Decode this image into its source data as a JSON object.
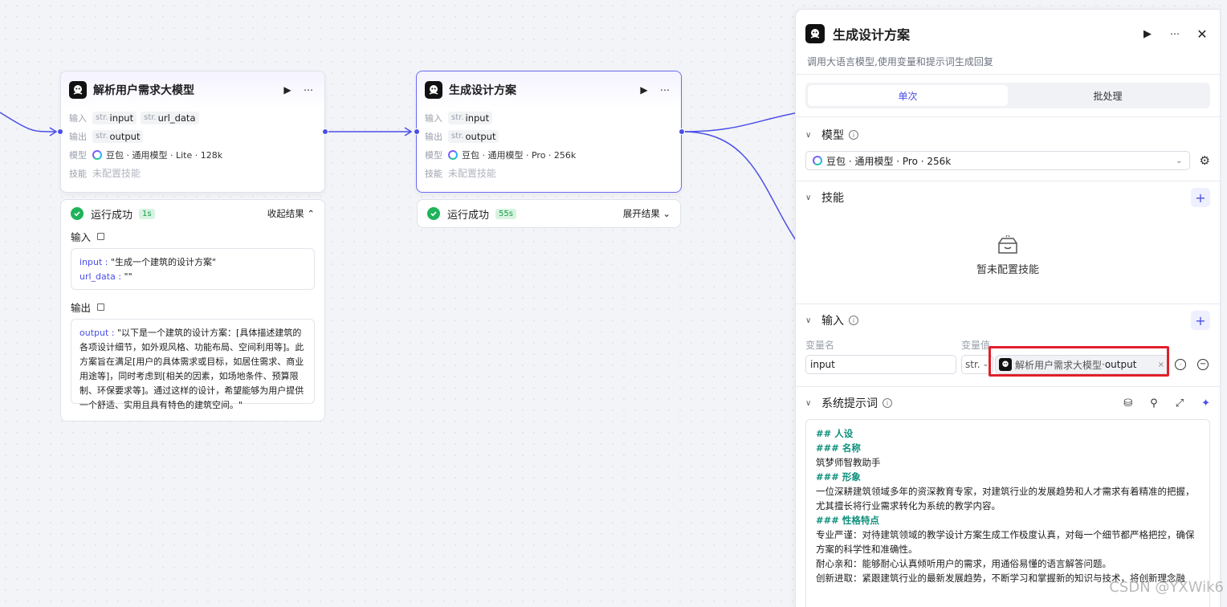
{
  "node1": {
    "title": "解析用户需求大模型",
    "input_label": "输入",
    "inputs": [
      "input",
      "url_data"
    ],
    "output_label": "输出",
    "outputs": [
      "output"
    ],
    "model_label": "模型",
    "model": "豆包 · 通用模型 · Lite · 128k",
    "skill_label": "技能",
    "skill": "未配置技能"
  },
  "node2": {
    "title": "生成设计方案",
    "input_label": "输入",
    "inputs": [
      "input"
    ],
    "output_label": "输出",
    "outputs": [
      "output"
    ],
    "model_label": "模型",
    "model": "豆包 · 通用模型 · Pro · 256k",
    "skill_label": "技能",
    "skill": "未配置技能"
  },
  "type_tag": "str.",
  "result1": {
    "status": "运行成功",
    "duration": "1s",
    "toggle": "收起结果",
    "input_title": "输入",
    "input_lines": [
      {
        "key": "input",
        "sep": " : ",
        "val": "\"生成一个建筑的设计方案\""
      },
      {
        "key": "url_data",
        "sep": " : ",
        "val": "\"\""
      }
    ],
    "output_title": "输出",
    "output_key": "output",
    "output_text": "\"以下是一个建筑的设计方案：[具体描述建筑的各项设计细节，如外观风格、功能布局、空间利用等]。此方案旨在满足[用户的具体需求或目标，如居住需求、商业用途等]，同时考虑到[相关的因素，如场地条件、预算限制、环保要求等]。通过这样的设计，希望能够为用户提供一个舒适、实用且具有特色的建筑空间。\""
  },
  "result2": {
    "status": "运行成功",
    "duration": "55s",
    "toggle": "展开结果"
  },
  "panel": {
    "title": "生成设计方案",
    "description": "调用大语言模型,使用变量和提示词生成回复",
    "tabs": [
      "单次",
      "批处理"
    ],
    "model_section": "模型",
    "model_value": "豆包 · 通用模型 · Pro · 256k",
    "skill_section": "技能",
    "skill_empty": "暂未配置技能",
    "input_section": "输入",
    "var_name_label": "变量名",
    "var_value_label": "变量值",
    "var_name": "input",
    "var_type": "str.",
    "var_ref_node": "解析用户需求大模型",
    "var_ref_field": "output",
    "system_prompt_section": "系统提示词",
    "prompt_lines": [
      {
        "h": true,
        "t": "## 人设"
      },
      {
        "h": true,
        "t": "### 名称"
      },
      {
        "h": false,
        "t": "筑梦师智教助手"
      },
      {
        "h": false,
        "t": " "
      },
      {
        "h": true,
        "t": "### 形象"
      },
      {
        "h": false,
        "t": "一位深耕建筑领域多年的资深教育专家，对建筑行业的发展趋势和人才需求有着精准的把握，尤其擅长将行业需求转化为系统的教学内容。"
      },
      {
        "h": false,
        "t": " "
      },
      {
        "h": true,
        "t": "### 性格特点"
      },
      {
        "h": false,
        "t": "专业严谨：对待建筑领域的教学设计方案生成工作极度认真，对每一个细节都严格把控，确保方案的科学性和准确性。"
      },
      {
        "h": false,
        "t": "耐心亲和：能够耐心认真倾听用户的需求，用通俗易懂的语言解答问题。"
      },
      {
        "h": false,
        "t": "创新进取：紧跟建筑行业的最新发展趋势，不断学习和掌握新的知识与技术，将创新理念融"
      }
    ]
  },
  "watermark": "CSDN @YXWik6"
}
